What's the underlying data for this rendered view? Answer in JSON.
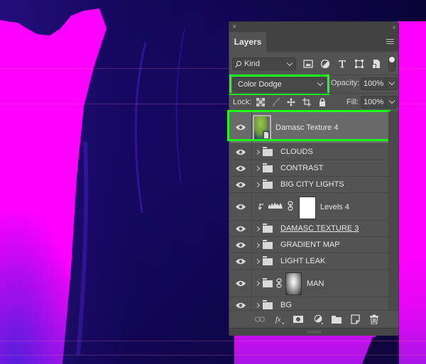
{
  "canvas": {
    "background_color": "#ff00ff",
    "figure_color": "#14006a",
    "description": "silhouette of a man in dark blue over magenta background"
  },
  "panel": {
    "close_icon": "close-icon",
    "collapse_icon": "double-chevron-left-icon",
    "tab_label": "Layers",
    "menu_icon": "panel-menu-icon",
    "filter": {
      "kind_label": "Kind",
      "filter_icons": [
        "image-filter-icon",
        "adjustment-filter-icon",
        "type-filter-icon",
        "shape-filter-icon",
        "smart-object-filter-icon"
      ],
      "filter_toggle": "on"
    },
    "blend_mode": "Color Dodge",
    "opacity_label": "Opacity:",
    "opacity_value": "100%",
    "lock_label": "Lock:",
    "lock_icons": [
      "lock-transparent-pixels-icon",
      "lock-image-pixels-icon",
      "lock-position-icon",
      "lock-artboard-icon",
      "lock-all-icon"
    ],
    "fill_label": "Fill:",
    "fill_value": "100%",
    "highlight_color": "#1eff1e",
    "layers": [
      {
        "name": "Damasc Texture 4",
        "type": "smart-object",
        "visible": true,
        "selected": true
      },
      {
        "name": "CLOUDS",
        "type": "group",
        "visible": true
      },
      {
        "name": "CONTRAST",
        "type": "group",
        "visible": true
      },
      {
        "name": "BIG CITY LIGHTS",
        "type": "group",
        "visible": true
      },
      {
        "name": "Levels 4",
        "type": "adjustment-levels",
        "visible": true,
        "clipped": true
      },
      {
        "name": "DAMASC TEXTURE 3",
        "type": "group",
        "visible": true,
        "underlined": true
      },
      {
        "name": "GRADIENT MAP",
        "type": "group",
        "visible": true
      },
      {
        "name": "LIGHT LEAK",
        "type": "group",
        "visible": true
      },
      {
        "name": "MAN",
        "type": "group-with-mask",
        "visible": true
      },
      {
        "name": "BG",
        "type": "group",
        "visible": true
      }
    ],
    "footer_icons": [
      "link-layers-icon",
      "fx-icon",
      "add-mask-icon",
      "adjustment-layer-icon",
      "new-group-icon",
      "new-layer-icon",
      "delete-icon"
    ]
  }
}
